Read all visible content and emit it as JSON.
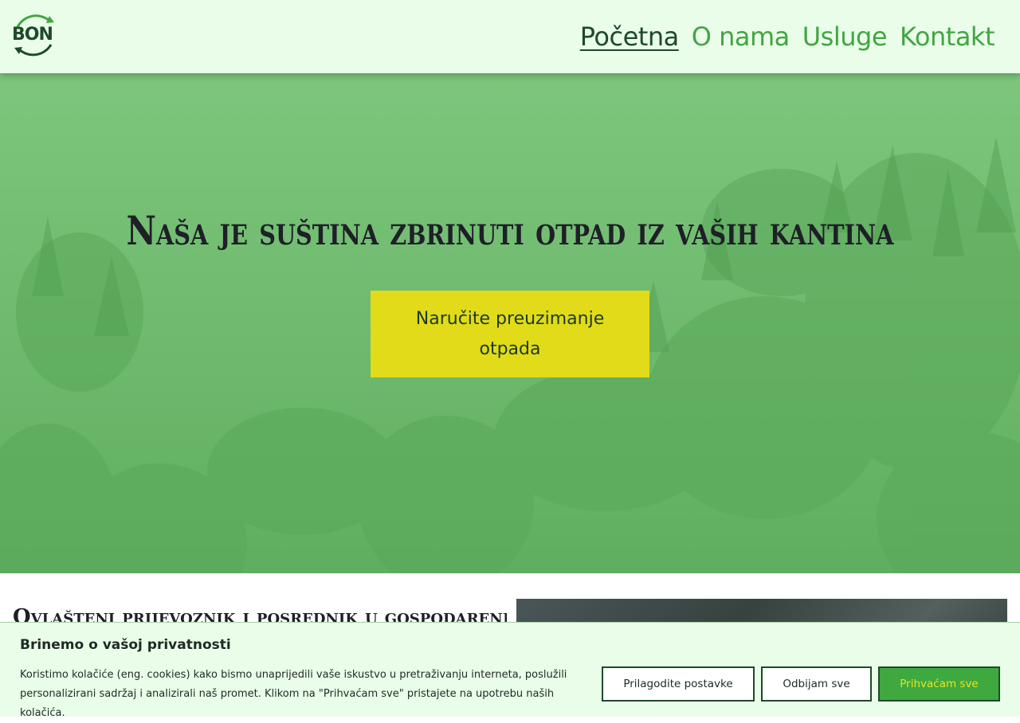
{
  "header": {
    "logo_text": "BON",
    "nav": [
      {
        "label": "Početna",
        "active": true
      },
      {
        "label": "O nama",
        "active": false
      },
      {
        "label": "Usluge",
        "active": false
      },
      {
        "label": "Kontakt",
        "active": false
      }
    ]
  },
  "hero": {
    "title": "Naša je suština zbrinuti otpad iz vaših kantina",
    "cta_label": "Naručite preuzimanje otpada"
  },
  "content": {
    "title": "Ovlašteni prijevoznik i posrednik u gospodarenju otpadom"
  },
  "cookie": {
    "title": "Brinemo o vašoj privatnosti",
    "text": "Koristimo kolačiće (eng. cookies) kako bismo unaprijedili vaše iskustvo u pretraživanju interneta, poslužili personalizirani sadržaj i analizirali naš promet. Klikom na \"Prihvaćam sve\" pristajete na upotrebu naših kolačića.",
    "customize_label": "Prilagodite postavke",
    "reject_label": "Odbijam sve",
    "accept_label": "Prihvaćam sve"
  },
  "colors": {
    "header_bg": "#e9fde9",
    "brand_green": "#43a543",
    "dark_green": "#1e4a2a",
    "cta_yellow": "#e1db19",
    "hero_overlay": "#7cc37c"
  },
  "icons": {
    "logo": "recycle-arrows-logo"
  }
}
